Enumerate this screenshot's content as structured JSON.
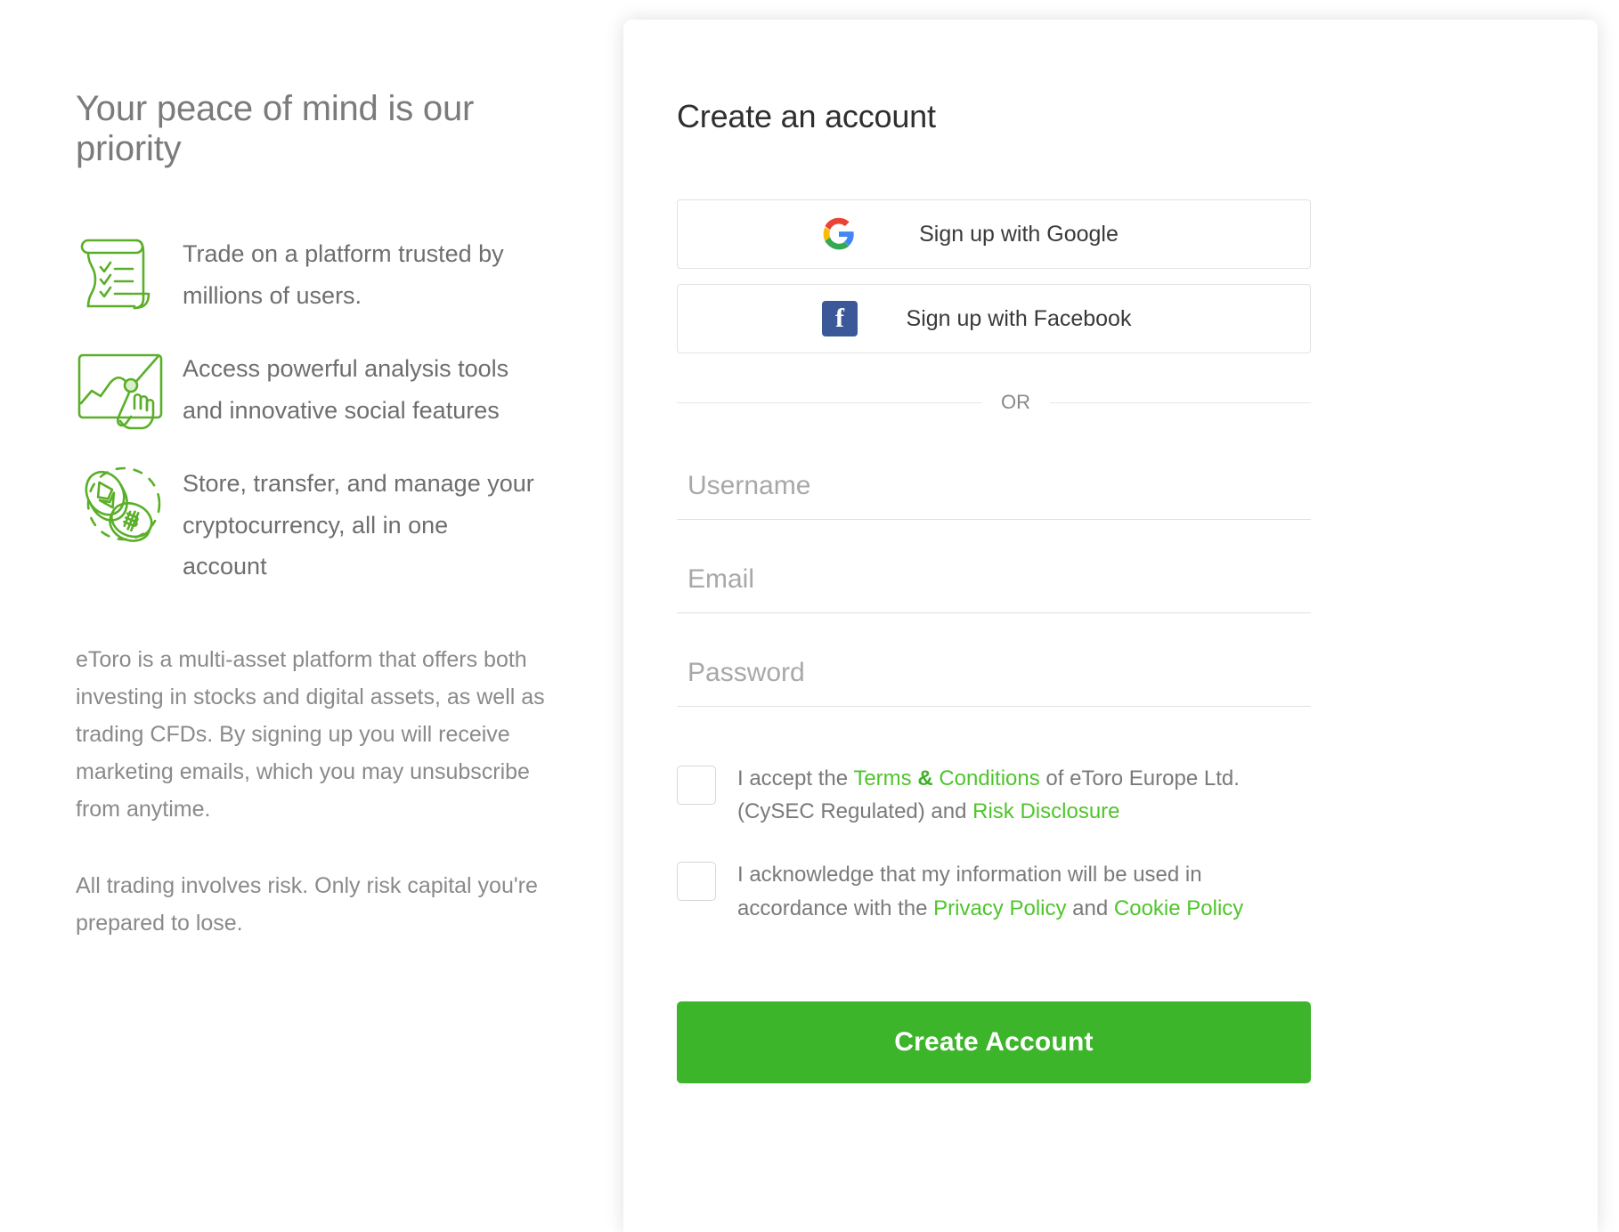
{
  "colors": {
    "brand_green": "#3cb52a",
    "link_green": "#4fc52c",
    "icon_green": "#5aaf28",
    "facebook_blue": "#3b5998",
    "text_grey": "#7a7a7a"
  },
  "left": {
    "headline": "Your peace of mind is our priority",
    "features": [
      {
        "icon": "scroll-checklist-icon",
        "text": "Trade on a platform trusted by millions of users."
      },
      {
        "icon": "chart-touch-icon",
        "text": "Access powerful analysis tools and innovative social features"
      },
      {
        "icon": "crypto-coins-icon",
        "text": "Store, transfer, and manage your cryptocurrency, all in one account"
      }
    ],
    "legal_paragraph": "eToro is a multi-asset platform that offers both investing in stocks and digital assets, as well as trading CFDs. By signing up you will receive marketing emails, which you may unsubscribe from anytime.",
    "risk_paragraph": "All trading involves risk. Only risk capital you're prepared to lose."
  },
  "form": {
    "title": "Create an account",
    "google_button": {
      "label": "Sign up with Google",
      "icon": "google-g-icon"
    },
    "facebook_button": {
      "label": "Sign up with Facebook",
      "icon": "facebook-f-icon",
      "glyph": "f"
    },
    "divider_label": "OR",
    "fields": {
      "username": {
        "placeholder": "Username",
        "value": ""
      },
      "email": {
        "placeholder": "Email",
        "value": ""
      },
      "password": {
        "placeholder": "Password",
        "value": ""
      }
    },
    "consent": [
      {
        "checked": false,
        "parts": [
          {
            "t": "I accept the ",
            "kind": "text"
          },
          {
            "t": "Terms",
            "kind": "link"
          },
          {
            "t": " & ",
            "kind": "amp"
          },
          {
            "t": "Conditions",
            "kind": "link"
          },
          {
            "t": " of eToro Europe Ltd. (CySEC Regulated) and ",
            "kind": "text"
          },
          {
            "t": "Risk Disclosure",
            "kind": "link"
          }
        ]
      },
      {
        "checked": false,
        "parts": [
          {
            "t": "I acknowledge that my information will be used in accordance with the ",
            "kind": "text"
          },
          {
            "t": "Privacy Policy",
            "kind": "link"
          },
          {
            "t": " and ",
            "kind": "text"
          },
          {
            "t": "Cookie Policy",
            "kind": "link"
          }
        ]
      }
    ],
    "submit_label": "Create Account"
  }
}
